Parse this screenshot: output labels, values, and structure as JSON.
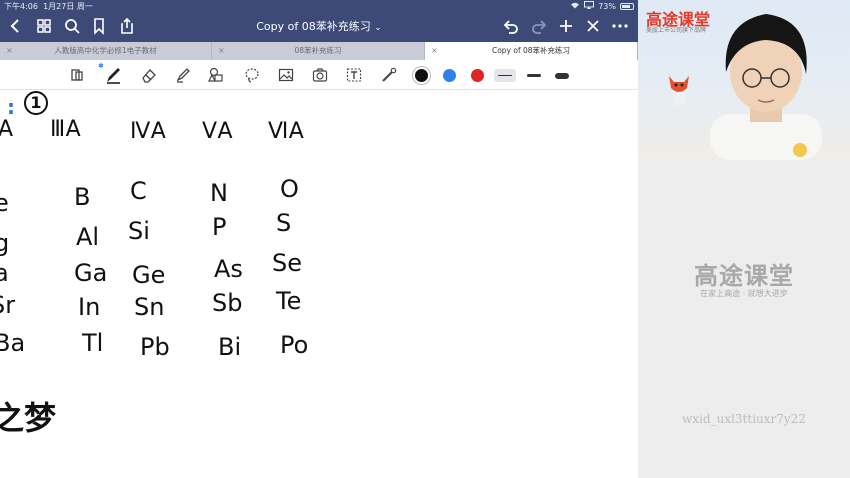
{
  "status_bar": {
    "time": "下午4:06",
    "date": "1月27日 周一",
    "battery": "73%"
  },
  "nav": {
    "doc_title": "Copy of 08苯补充练习",
    "title_chevron": "⌄"
  },
  "tabs": [
    {
      "label": "人教版高中化学必修1电子教材",
      "active": false
    },
    {
      "label": "08苯补充练习",
      "active": false
    },
    {
      "label": "Copy of 08苯补充练习",
      "active": true
    }
  ],
  "tab_close_glyph": "×",
  "colors": {
    "header_bg": "#3d4a78",
    "pen_black": "#111111",
    "pen_blue": "#2d83e8",
    "pen_red": "#e02424",
    "brand_red": "#e23b2a"
  },
  "toolbar": {
    "icons": [
      "lasso-select-icon",
      "pen-icon",
      "eraser-icon",
      "highlighter-icon",
      "shapes-icon",
      "lasso-icon",
      "image-icon",
      "camera-icon",
      "text-box-icon",
      "laser-pointer-icon"
    ],
    "colors": [
      "black",
      "blue",
      "red"
    ],
    "line_widths": [
      "thin",
      "medium",
      "thick"
    ],
    "selected_color": "black",
    "selected_width": "thin"
  },
  "notes": {
    "section_mark": "1",
    "colon_mark": ":",
    "groups": [
      "A",
      "ⅢA",
      "ⅣA",
      "ⅤA",
      "ⅥA"
    ],
    "rows": [
      [
        "e",
        "B",
        "C",
        "N",
        "O"
      ],
      [
        "g",
        "Al",
        "Si",
        "P",
        "S"
      ],
      [
        "a",
        "Ga",
        "Ge",
        "As",
        "Se"
      ],
      [
        "Sr",
        "In",
        "Sn",
        "Sb",
        "Te"
      ],
      [
        "Ba",
        "Tl",
        "Pb",
        "Bi",
        "Po"
      ]
    ],
    "brand_text": "之梦"
  },
  "side_panel": {
    "video_logo": "高途课堂",
    "video_sub": "美股上市公司旗下品牌",
    "logo_big": "高途课堂",
    "logo_small": "在家上高途 · 就想大进步",
    "watermark": "wxid_uxl3ttiuxr7y22"
  }
}
